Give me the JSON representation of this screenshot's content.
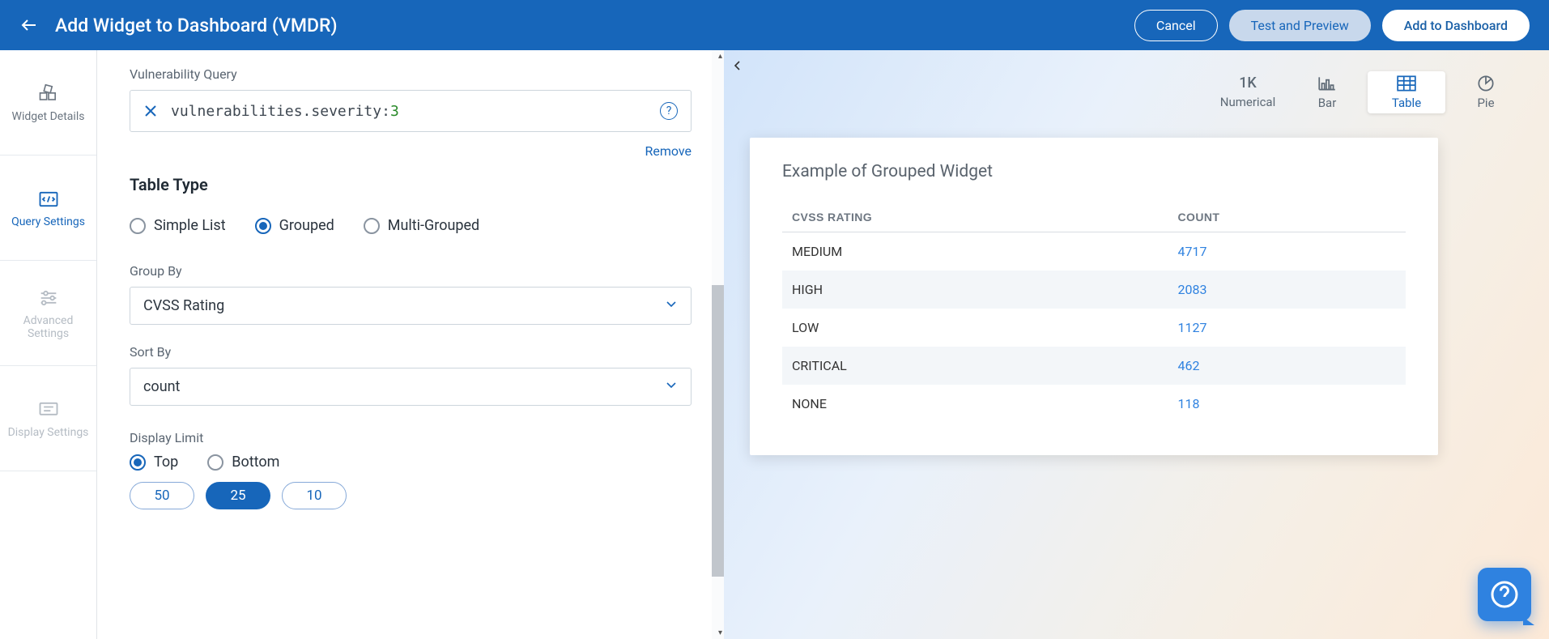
{
  "header": {
    "title": "Add Widget to Dashboard (VMDR)",
    "cancel": "Cancel",
    "test_preview": "Test and Preview",
    "add": "Add to Dashboard"
  },
  "tabs": {
    "widget_details": "Widget Details",
    "query_settings": "Query Settings",
    "advanced_settings": "Advanced Settings",
    "display_settings": "Display Settings"
  },
  "form": {
    "vuln_query_label": "Vulnerability Query",
    "query_text_prefix": "vulnerabilities.severity:",
    "query_text_value": "3",
    "remove": "Remove",
    "table_type_heading": "Table Type",
    "type_options": {
      "simple": "Simple List",
      "grouped": "Grouped",
      "multi": "Multi-Grouped"
    },
    "group_by_label": "Group By",
    "group_by_value": "CVSS Rating",
    "sort_by_label": "Sort By",
    "sort_by_value": "count",
    "display_limit_label": "Display Limit",
    "limit_dir": {
      "top": "Top",
      "bottom": "Bottom"
    },
    "pills": {
      "p50": "50",
      "p25": "25",
      "p10": "10"
    }
  },
  "preview": {
    "chart_types": {
      "numerical": "Numerical",
      "numerical_glyph": "1K",
      "bar": "Bar",
      "table": "Table",
      "pie": "Pie"
    },
    "card_title": "Example of Grouped Widget",
    "table": {
      "head_rating": "CVSS RATING",
      "head_count": "COUNT",
      "rows": [
        {
          "rating": "MEDIUM",
          "count": "4717"
        },
        {
          "rating": "HIGH",
          "count": "2083"
        },
        {
          "rating": "LOW",
          "count": "1127"
        },
        {
          "rating": "CRITICAL",
          "count": "462"
        },
        {
          "rating": "NONE",
          "count": "118"
        }
      ]
    }
  },
  "chart_data": {
    "type": "table",
    "title": "Example of Grouped Widget",
    "categories": [
      "MEDIUM",
      "HIGH",
      "LOW",
      "CRITICAL",
      "NONE"
    ],
    "values": [
      4717,
      2083,
      1127,
      462,
      118
    ],
    "xlabel": "CVSS RATING",
    "ylabel": "COUNT"
  }
}
